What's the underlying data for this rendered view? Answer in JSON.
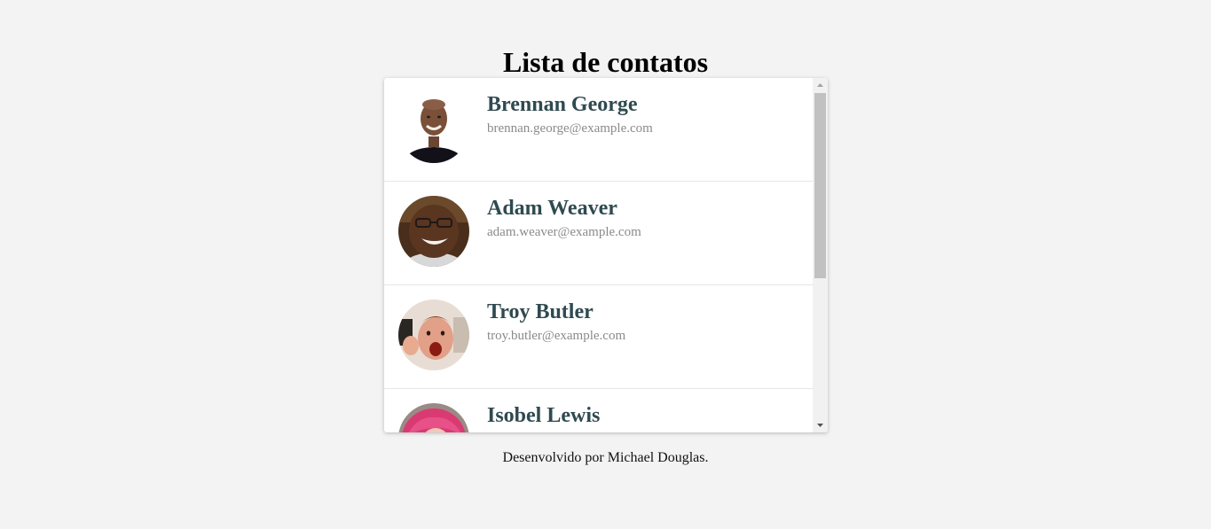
{
  "header": {
    "title": "Lista de contatos"
  },
  "contacts": [
    {
      "name": "Brennan George",
      "email": "brennan.george@example.com",
      "avatar_icon": "person-photo-avatar"
    },
    {
      "name": "Adam Weaver",
      "email": "adam.weaver@example.com",
      "avatar_icon": "person-photo-avatar"
    },
    {
      "name": "Troy Butler",
      "email": "troy.butler@example.com",
      "avatar_icon": "person-photo-avatar"
    },
    {
      "name": "Isobel Lewis",
      "email": "",
      "avatar_icon": "person-photo-avatar"
    }
  ],
  "footer": {
    "credit": "Desenvolvido por Michael Douglas."
  },
  "colors": {
    "background": "#f3f3f3",
    "name_text": "#2f4a50",
    "email_text": "#8a8a8a",
    "scroll_thumb": "#c1c1c1"
  }
}
